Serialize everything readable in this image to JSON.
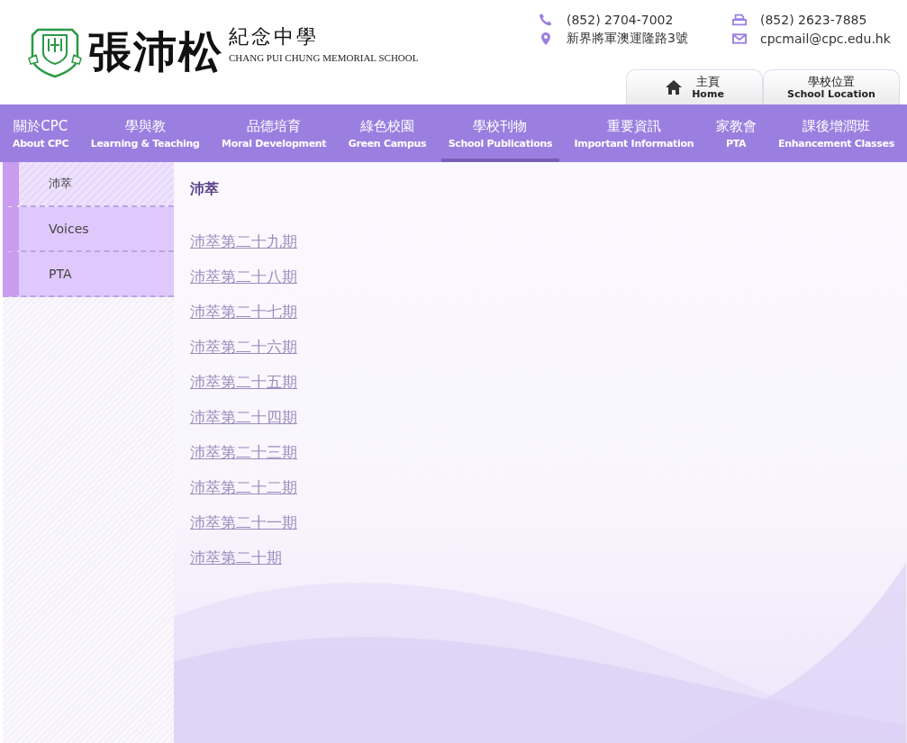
{
  "logo": {
    "name_large": "張沛松",
    "name_small": "紀念中學",
    "name_english": "CHANG PUI CHUNG MEMORIAL SCHOOL"
  },
  "contacts": [
    {
      "kind": "phone",
      "text": "(852) 2704-7002"
    },
    {
      "kind": "fax",
      "text": "(852) 2623-7885"
    },
    {
      "kind": "address",
      "text": "新界將軍澳運隆路3號"
    },
    {
      "kind": "email",
      "text": "cpcmail@cpc.edu.hk"
    }
  ],
  "quick_tabs": [
    {
      "kind": "home",
      "label": "主頁",
      "sublabel": "Home"
    },
    {
      "kind": "plain",
      "label": "學校位置",
      "sublabel": "School Location"
    }
  ],
  "nav": [
    {
      "label": "關於CPC",
      "sublabel": "About CPC",
      "selected": false
    },
    {
      "label": "學與教",
      "sublabel": "Learning & Teaching",
      "selected": false
    },
    {
      "label": "品德培育",
      "sublabel": "Moral Development",
      "selected": false
    },
    {
      "label": "綠色校園",
      "sublabel": "Green Campus",
      "selected": false
    },
    {
      "label": "學校刊物",
      "sublabel": "School Publications",
      "selected": true
    },
    {
      "label": "重要資訊",
      "sublabel": "Important Information",
      "selected": false
    },
    {
      "label": "家教會",
      "sublabel": "PTA",
      "selected": false
    },
    {
      "label": "課後增潤班",
      "sublabel": "Enhancement Classes",
      "selected": false
    }
  ],
  "sidebar": {
    "items": [
      {
        "label": "沛萃",
        "selected": true
      },
      {
        "label": "Voices",
        "selected": false
      },
      {
        "label": "PTA",
        "selected": false
      }
    ]
  },
  "content": {
    "heading": "沛萃",
    "links": [
      "沛萃第二十九期",
      "沛萃第二十八期",
      "沛萃第二十七期",
      "沛萃第二十六期",
      "沛萃第二十五期",
      "沛萃第二十四期",
      "沛萃第二十三期",
      "沛萃第二十二期",
      "沛萃第二十一期",
      "沛萃第二十期"
    ]
  }
}
